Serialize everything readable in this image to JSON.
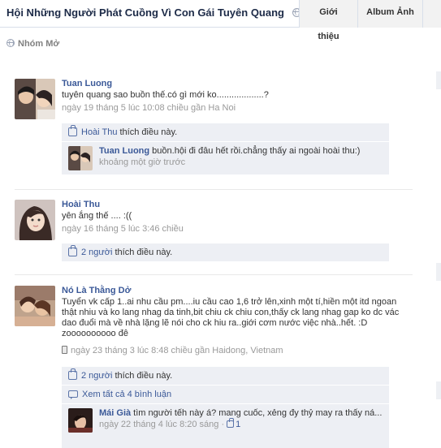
{
  "header": {
    "group_title": "Hội Những Người Phát Cuồng Vì Con Gái Tuyên Quang",
    "tabs": [
      "Giới thiệu",
      "Album Ảnh"
    ]
  },
  "privacy": {
    "label": "Nhóm Mở"
  },
  "posts": [
    {
      "author": "Tuan Luong",
      "message": "tuyên quang sao buồn thế.có gì mới ko...................?",
      "meta": "ngày 19 tháng 5 lúc 10:08 chiều gần Ha Noi",
      "likes": {
        "name": "Hoài Thu",
        "text": " thích điều này."
      },
      "comment": {
        "author": "Tuan Luong",
        "text": " buồn.hội đi đâu hết rồi.chẳng thấy ai ngoài hoài thu:)",
        "meta": "khoảng một giờ trước"
      }
    },
    {
      "author": "Hoài Thu",
      "message": "yên ắng thế .... :((",
      "meta": "ngày 16 tháng 5 lúc 3:46 chiều",
      "likes": {
        "name": "2 người",
        "text": " thích điều này."
      }
    },
    {
      "author": "Nó Là Thằng Dở",
      "message": "Tuyển vk cấp 1..ai nhu cầu pm....iu cầu cao 1,6 trở lên,xinh một tí,hiền một itd ngoan thật nhiu và ko lang nhag da tinh,bit chiu ck chiu con,thấy ck lang nhag gap ko dc vác dao đuổi mà về nhà lặng lẽ nói cho ck hiu ra..giới cơm nước việc nhà..hết. :D zoooooooooo đê",
      "meta": "ngày 23 tháng 3 lúc 8:48 chiều gần Haidong, Vietnam",
      "likes": {
        "name": "2 người",
        "text": " thích điều này."
      },
      "view_all": "Xem tất cả 4 bình luận",
      "comment": {
        "author": "Mái Già",
        "text": " tìm người tếh này á? mang cuốc, xẻng đy thỷ may ra thấy ná...",
        "meta": "ngày 22 tháng 4 lúc 8:20 sáng · ",
        "like_count": "1"
      }
    }
  ],
  "colors": {
    "link": "#3b5998",
    "feedback_bg": "#edeff4",
    "meta": "#999999"
  }
}
